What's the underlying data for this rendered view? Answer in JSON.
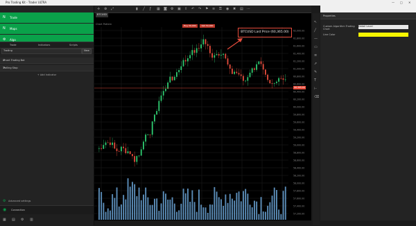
{
  "window": {
    "title": "Pro Trading Kit - Trader ULTRA",
    "controls": [
      "—",
      "□",
      "✕"
    ]
  },
  "nav": {
    "items": [
      {
        "label": "Trade",
        "icon": "N"
      },
      {
        "label": "Maps",
        "icon": "N"
      },
      {
        "label": "Algo",
        "icon": "⚙"
      }
    ]
  },
  "left_tabs": [
    "Trade",
    "Indicators",
    "Scripts"
  ],
  "strategy": {
    "selected": "Trading",
    "new_label": "New"
  },
  "sections": [
    {
      "label": "Smart Trading Bot",
      "action": "⇗"
    },
    {
      "label": "Trailing Stop",
      "action": "⇗"
    }
  ],
  "add_indicator": "+ Add Indicator",
  "advanced_label": "Advanced settings",
  "connection_label": "Connection",
  "chart": {
    "symbol": "BTCUSD",
    "legend": "Chart Pattern",
    "buy_label": "Buy 50,000",
    "sell_label": "Sell 50,000",
    "annotation": "BTCUSD Last Price (60,365.00)",
    "price_badge": "60,365.00",
    "price_ticks": [
      "62,000.00",
      "61,800.00",
      "61,600.00",
      "61,400.00",
      "61,200.00",
      "61,000.00",
      "60,800.00",
      "60,600.00",
      "60,400.00",
      "60,200.00",
      "60,000.00",
      "59,800.00",
      "59,600.00",
      "59,400.00",
      "59,200.00",
      "59,000.00",
      "58,800.00",
      "58,600.00",
      "58,400.00",
      "58,200.00",
      "58,000.00",
      "57,800.00",
      "57,600.00",
      "57,400.00",
      "57,200.00",
      "57,000.00"
    ]
  },
  "properties": {
    "header": "Properties",
    "rows": [
      {
        "name": "Custom Algorithm Trading Chart",
        "value": "Detail Level"
      },
      {
        "name": "Line Color",
        "value": ""
      }
    ],
    "line_color": "#f5f500"
  },
  "colors": {
    "accent": "#0aa14a",
    "price_line": "#e74c3c",
    "bull": "#2ecc71",
    "bear": "#e74c3c",
    "volume": "#5b8db8"
  }
}
